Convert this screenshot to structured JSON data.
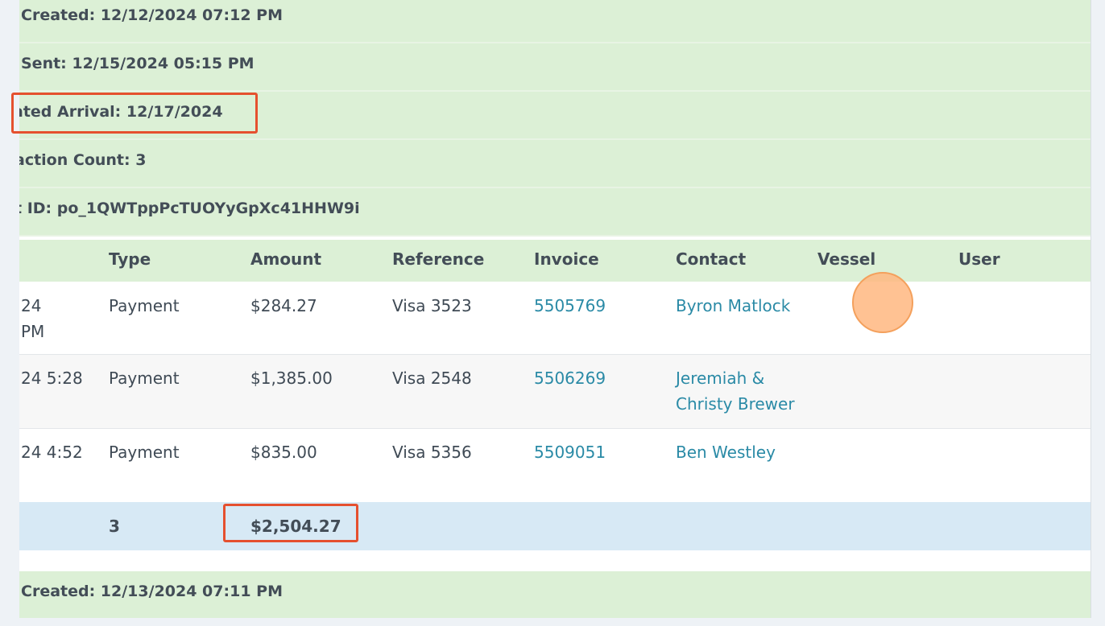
{
  "payout_a": {
    "created": "Created: 12/12/2024 07:12 PM",
    "sent": "Sent: 12/15/2024 05:15 PM",
    "estimated_arrival": "ated Arrival: 12/17/2024",
    "transaction_count": "action Count: 3",
    "payout_id": "t ID: po_1QWTppPcTUOYyGpXc41HHW9i"
  },
  "table": {
    "headers": [
      "Type",
      "Amount",
      "Reference",
      "Invoice",
      "Contact",
      "Vessel",
      "User"
    ],
    "rows": [
      {
        "date_line1": "24",
        "date_line2": "PM",
        "type": "Payment",
        "amount": "$284.27",
        "reference": "Visa 3523",
        "invoice": "5505769",
        "contact_line1": "Byron Matlock",
        "contact_line2": ""
      },
      {
        "date_line1": "24 5:28",
        "date_line2": "",
        "type": "Payment",
        "amount": "$1,385.00",
        "reference": "Visa 2548",
        "invoice": "5506269",
        "contact_line1": "Jeremiah &",
        "contact_line2": "Christy Brewer"
      },
      {
        "date_line1": "24 4:52",
        "date_line2": "",
        "type": "Payment",
        "amount": "$835.00",
        "reference": "Visa 5356",
        "invoice": "5509051",
        "contact_line1": "Ben Westley",
        "contact_line2": ""
      }
    ],
    "totals": {
      "count": "3",
      "amount": "$2,504.27"
    }
  },
  "payout_b": {
    "created": "Created: 12/13/2024 07:11 PM"
  },
  "colors": {
    "meta_bg": "#dcf0d6",
    "total_bg": "#d7e9f5",
    "link": "#2a8aa6",
    "highlight": "#e5502f"
  }
}
